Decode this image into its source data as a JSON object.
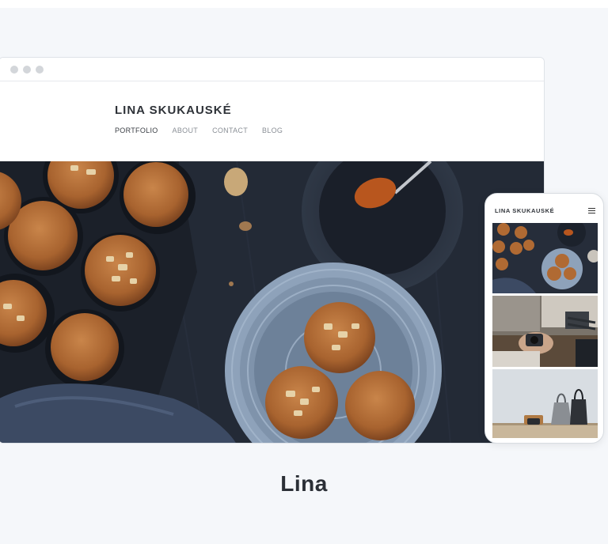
{
  "site": {
    "logo": "LINA SKUKAUSKÉ",
    "nav": [
      "PORTFOLIO",
      "ABOUT",
      "CONTACT",
      "BLOG"
    ]
  },
  "mobile": {
    "logo": "LINA SKUKAUSKÉ"
  },
  "caption": "Lina",
  "colors": {
    "page_bg": "#f5f7fa",
    "hero_dark": "#232a36",
    "muffin": "#b9733a",
    "plate": "#8ea2ba"
  },
  "icons": [
    "menu-icon"
  ]
}
